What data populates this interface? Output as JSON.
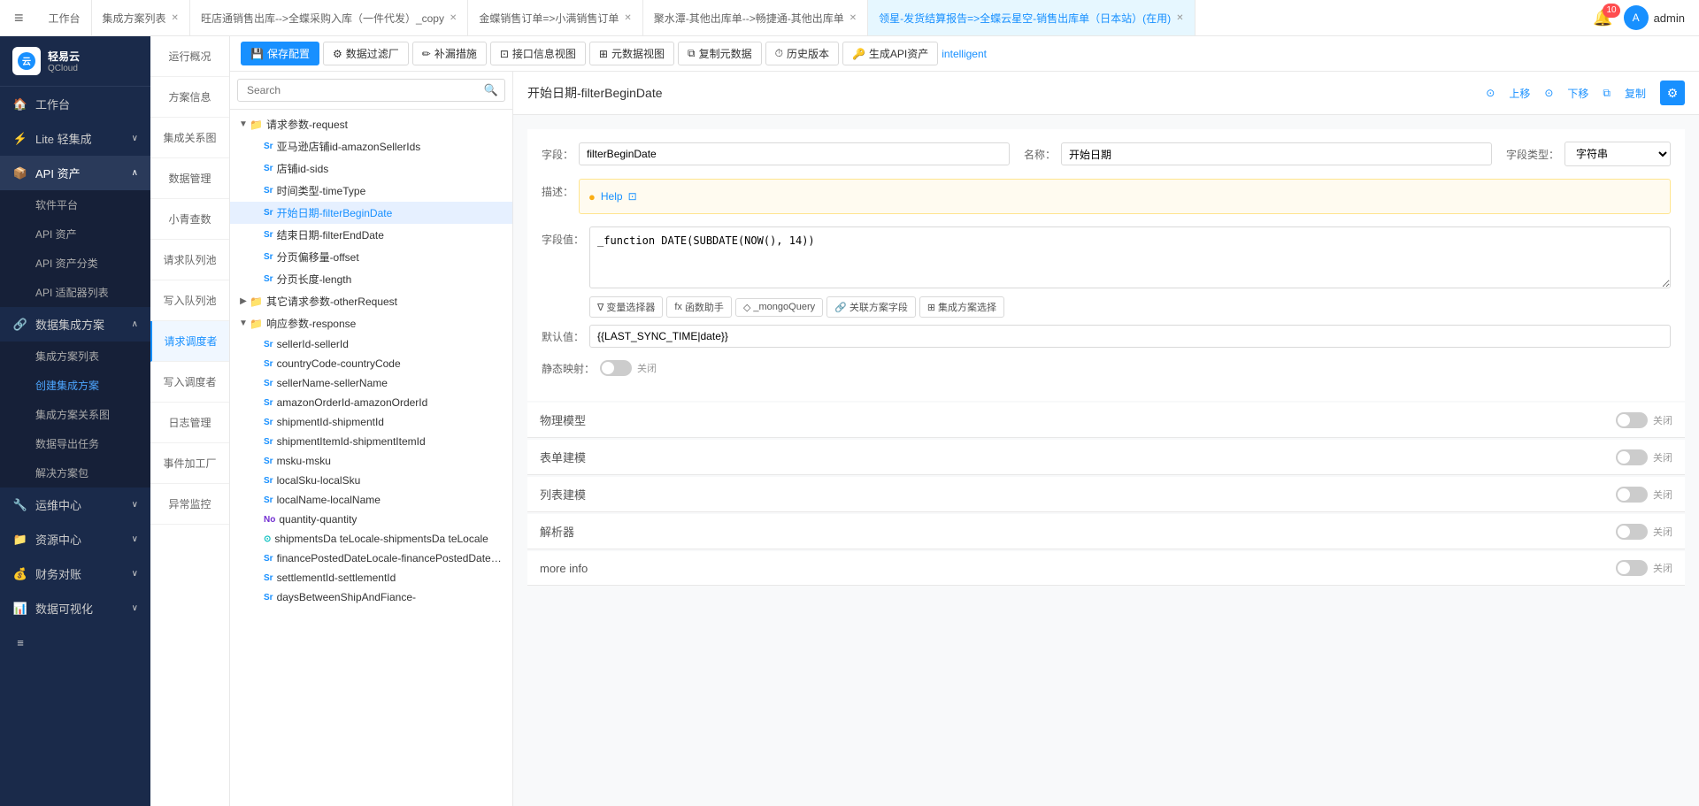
{
  "app": {
    "logo_text": "轻易云",
    "logo_sub": "QCloud",
    "menu_icon": "≡"
  },
  "top_tabs": [
    {
      "id": "workbench",
      "label": "工作台",
      "closable": false,
      "active": false
    },
    {
      "id": "solution_list",
      "label": "集成方案列表",
      "closable": true,
      "active": false
    },
    {
      "id": "wangdian",
      "label": "旺店通销售出库-->全蝶采购入库（一件代发）_copy",
      "closable": true,
      "active": false
    },
    {
      "id": "jindie",
      "label": "金蝶销售订单=>小满销售订单",
      "closable": true,
      "active": false
    },
    {
      "id": "juhui",
      "label": "聚水潭-其他出库单-->畅捷通-其他出库单",
      "closable": true,
      "active": false
    },
    {
      "id": "lingyu",
      "label": "领星-发货结算报告=>全蝶云星空-销售出库单（日本站）(在用)",
      "closable": true,
      "active": true
    }
  ],
  "top_right": {
    "notifications": "10",
    "user": "admin"
  },
  "sidebar": {
    "items": [
      {
        "id": "workbench",
        "label": "工作台",
        "icon": "🏠",
        "active": false,
        "expandable": false
      },
      {
        "id": "lite",
        "label": "Lite 轻集成",
        "icon": "⚡",
        "active": false,
        "expandable": true
      },
      {
        "id": "api_asset",
        "label": "API 资产",
        "icon": "📦",
        "active": true,
        "expandable": true
      },
      {
        "id": "data_solution",
        "label": "数据集成方案",
        "icon": "🔗",
        "active": false,
        "expandable": true
      },
      {
        "id": "ops",
        "label": "运维中心",
        "icon": "🔧",
        "active": false,
        "expandable": true
      },
      {
        "id": "resources",
        "label": "资源中心",
        "icon": "📁",
        "active": false,
        "expandable": true
      },
      {
        "id": "finance",
        "label": "财务对账",
        "icon": "💰",
        "active": false,
        "expandable": true
      },
      {
        "id": "data_viz",
        "label": "数据可视化",
        "icon": "📊",
        "active": false,
        "expandable": true
      }
    ],
    "api_submenu": [
      {
        "id": "software_platform",
        "label": "软件平台"
      },
      {
        "id": "api_asset",
        "label": "API 资产"
      },
      {
        "id": "api_classification",
        "label": "API 资产分类"
      },
      {
        "id": "api_adapter",
        "label": "API 适配器列表"
      }
    ],
    "data_submenu": [
      {
        "id": "solution_list",
        "label": "集成方案列表"
      },
      {
        "id": "create_solution",
        "label": "创建集成方案"
      },
      {
        "id": "solution_relation",
        "label": "集成方案关系图"
      },
      {
        "id": "data_export",
        "label": "数据导出任务"
      },
      {
        "id": "solution_package",
        "label": "解决方案包"
      }
    ]
  },
  "second_nav": {
    "items": [
      {
        "id": "overview",
        "label": "运行概况"
      },
      {
        "id": "solution_info",
        "label": "方案信息"
      },
      {
        "id": "integration_graph",
        "label": "集成关系图"
      },
      {
        "id": "data_mgmt",
        "label": "数据管理"
      },
      {
        "id": "small_green",
        "label": "小青查数"
      },
      {
        "id": "request_queue",
        "label": "请求队列池"
      },
      {
        "id": "write_queue",
        "label": "写入队列池"
      },
      {
        "id": "request_debugger",
        "label": "请求调度者",
        "active": true
      },
      {
        "id": "write_debugger",
        "label": "写入调度者"
      },
      {
        "id": "log_mgmt",
        "label": "日志管理"
      },
      {
        "id": "event_factory",
        "label": "事件加工厂"
      },
      {
        "id": "exception_monitor",
        "label": "异常监控"
      }
    ]
  },
  "toolbar": {
    "save_config": "保存配置",
    "data_filter": "数据过滤厂",
    "remediation": "补漏措施",
    "interface_view": "接口信息视图",
    "meta_view": "元数据视图",
    "copy_meta": "复制元数据",
    "history": "历史版本",
    "gen_api": "生成API资产",
    "intelligent": "intelligent"
  },
  "search": {
    "placeholder": "Search"
  },
  "tree": {
    "nodes": [
      {
        "id": "request_params",
        "label": "请求参数-request",
        "type": "folder",
        "level": 0,
        "expanded": true
      },
      {
        "id": "amazon_seller_ids",
        "label": "亚马逊店铺id-amazonSellerIds",
        "type": "Sr",
        "level": 1
      },
      {
        "id": "shop_id_sids",
        "label": "店铺id-sids",
        "type": "Sr",
        "level": 1
      },
      {
        "id": "time_type",
        "label": "时间类型-timeType",
        "type": "Sr",
        "level": 1
      },
      {
        "id": "filter_begin_date",
        "label": "开始日期-filterBeginDate",
        "type": "Sr",
        "level": 1,
        "selected": true
      },
      {
        "id": "filter_end_date",
        "label": "结束日期-filterEndDate",
        "type": "Sr",
        "level": 1
      },
      {
        "id": "offset",
        "label": "分页偏移量-offset",
        "type": "Sr",
        "level": 1
      },
      {
        "id": "length",
        "label": "分页长度-length",
        "type": "Sr",
        "level": 1
      },
      {
        "id": "other_request",
        "label": "其它请求参数-otherRequest",
        "type": "folder",
        "level": 0,
        "expanded": false
      },
      {
        "id": "response_params",
        "label": "响应参数-response",
        "type": "folder",
        "level": 0,
        "expanded": true
      },
      {
        "id": "seller_id",
        "label": "sellerId-sellerId",
        "type": "Sr",
        "level": 1
      },
      {
        "id": "country_code",
        "label": "countryCode-countryCode",
        "type": "Sr",
        "level": 1
      },
      {
        "id": "seller_name",
        "label": "sellerName-sellerName",
        "type": "Sr",
        "level": 1
      },
      {
        "id": "amazon_order_id",
        "label": "amazonOrderId-amazonOrderId",
        "type": "Sr",
        "level": 1
      },
      {
        "id": "shipment_id",
        "label": "shipmentId-shipmentId",
        "type": "Sr",
        "level": 1
      },
      {
        "id": "shipment_item_id",
        "label": "shipmentItemId-shipmentItemId",
        "type": "Sr",
        "level": 1
      },
      {
        "id": "msku",
        "label": "msku-msku",
        "type": "Sr",
        "level": 1
      },
      {
        "id": "local_sku",
        "label": "localSku-localSku",
        "type": "Sr",
        "level": 1
      },
      {
        "id": "local_name",
        "label": "localName-localName",
        "type": "Sr",
        "level": 1
      },
      {
        "id": "quantity",
        "label": "quantity-quantity",
        "type": "No",
        "level": 1
      },
      {
        "id": "shipments_date_locale",
        "label": "shipmentsDa teLocale-shipmentsDa teLocale",
        "type": "⊙",
        "level": 1
      },
      {
        "id": "finance_posted_date",
        "label": "financePostedDateLocale-financePostedDateLocale",
        "type": "Sr",
        "level": 1
      },
      {
        "id": "settlement_id",
        "label": "settlementId-settlementId",
        "type": "Sr",
        "level": 1
      },
      {
        "id": "days_between",
        "label": "daysBetweenShipAndFiance-",
        "type": "Sr",
        "level": 1
      }
    ]
  },
  "detail": {
    "title": "开始日期-filterBeginDate",
    "actions": {
      "up": "上移",
      "down": "下移",
      "copy": "复制"
    },
    "field_label": "字段：",
    "field_value": "filterBeginDate",
    "name_label": "名称：",
    "name_value": "开始日期",
    "type_label": "字段类型：",
    "type_value": "字符串",
    "desc_label": "描述：",
    "desc_help": "Help",
    "field_val_label": "字段值：",
    "field_val_content": "_function DATE(SUBDATE(NOW(), 14))",
    "default_label": "默认值：",
    "default_value": "{{LAST_SYNC_TIME|date}}",
    "static_label": "静态映射：",
    "static_value": "关闭",
    "func_buttons": [
      {
        "id": "var_selector",
        "label": "变量选择器",
        "icon": "∇"
      },
      {
        "id": "func_helper",
        "label": "函数助手",
        "icon": "fx"
      },
      {
        "id": "mongo_query",
        "label": "_mongoQuery",
        "icon": "◇"
      },
      {
        "id": "related_field",
        "label": "关联方案字段",
        "icon": "🔗"
      },
      {
        "id": "solution_select",
        "label": "集成方案选择",
        "icon": "⊞"
      }
    ],
    "sections": [
      {
        "id": "physical_model",
        "label": "物理模型",
        "enabled": false,
        "toggle_label": "关闭"
      },
      {
        "id": "table_build",
        "label": "表单建模",
        "enabled": false,
        "toggle_label": "关闭"
      },
      {
        "id": "list_build",
        "label": "列表建模",
        "enabled": false,
        "toggle_label": "关闭"
      },
      {
        "id": "parser",
        "label": "解析器",
        "enabled": false,
        "toggle_label": "关闭"
      }
    ],
    "more_info": "more info",
    "more_info_toggle": "关闭"
  }
}
